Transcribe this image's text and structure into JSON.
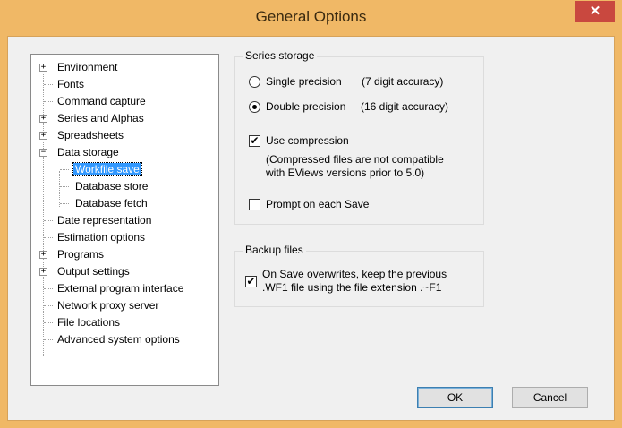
{
  "window": {
    "title": "General Options",
    "close_glyph": "✕"
  },
  "tree": {
    "items": [
      {
        "label": "Environment",
        "expander": "+"
      },
      {
        "label": "Fonts"
      },
      {
        "label": "Command capture"
      },
      {
        "label": "Series and Alphas",
        "expander": "+"
      },
      {
        "label": "Spreadsheets",
        "expander": "+"
      },
      {
        "label": "Data storage",
        "expander": "−"
      },
      {
        "label": "Workfile save",
        "selected": true
      },
      {
        "label": "Database store"
      },
      {
        "label": "Database fetch"
      },
      {
        "label": "Date representation"
      },
      {
        "label": "Estimation options"
      },
      {
        "label": "Programs",
        "expander": "+"
      },
      {
        "label": "Output settings",
        "expander": "+"
      },
      {
        "label": "External program interface"
      },
      {
        "label": "Network proxy server"
      },
      {
        "label": "File locations"
      },
      {
        "label": "Advanced system options"
      }
    ]
  },
  "series_storage": {
    "title": "Series storage",
    "single_precision": {
      "label": "Single precision",
      "note": "(7 digit accuracy)",
      "selected": false
    },
    "double_precision": {
      "label": "Double precision",
      "note": "(16 digit accuracy)",
      "selected": true
    },
    "use_compression": {
      "label": "Use compression",
      "checked": true
    },
    "compression_note_line1": "(Compressed files are not compatible",
    "compression_note_line2": "with EViews versions prior to 5.0)",
    "prompt_on_save": {
      "label": "Prompt on each Save",
      "checked": false
    }
  },
  "backup_files": {
    "title": "Backup files",
    "overwrite": {
      "checked": true,
      "line1": "On Save overwrites, keep the previous",
      "line2": ".WF1 file using the file extension .~F1"
    }
  },
  "buttons": {
    "ok": "OK",
    "cancel": "Cancel"
  },
  "colors": {
    "titlebar": "#f0b866",
    "close": "#c9483f",
    "selection": "#3399ff"
  },
  "icons": {
    "check": "✔"
  }
}
